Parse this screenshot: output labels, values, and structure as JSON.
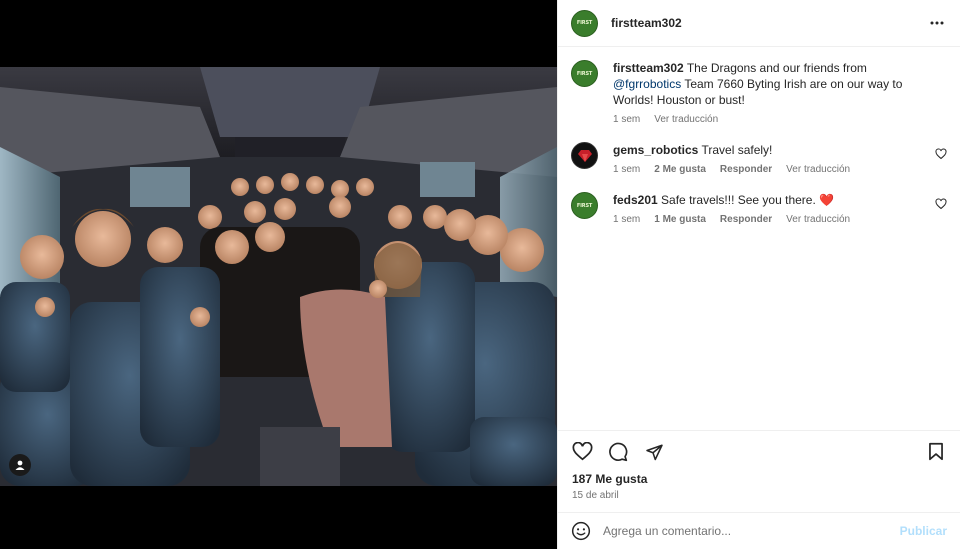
{
  "header": {
    "username": "firstteam302",
    "avatar_icon": "team-logo-icon",
    "more_icon": "more-options-icon"
  },
  "caption": {
    "username": "firstteam302",
    "text_before": "The Dragons and our friends from ",
    "mention": "@fgrrobotics",
    "text_after": " Team 7660 Byting Irish are on our way to Worlds! Houston or bust!",
    "time": "1 sem",
    "translate": "Ver traducción"
  },
  "comments": [
    {
      "username": "gems_robotics",
      "text": "Travel safely!",
      "time": "1 sem",
      "likes": "2 Me gusta",
      "reply": "Responder",
      "translate": "Ver traducción"
    },
    {
      "username": "feds201",
      "text": "Safe travels!!! See you there. ",
      "emoji": "❤️",
      "time": "1 sem",
      "likes": "1 Me gusta",
      "reply": "Responder",
      "translate": "Ver traducción"
    }
  ],
  "actions": {
    "like_icon": "heart-icon",
    "comment_icon": "comment-icon",
    "share_icon": "share-icon",
    "save_icon": "bookmark-icon"
  },
  "likes_count": "187 Me gusta",
  "date": "15 de abril",
  "add_comment": {
    "placeholder": "Agrega un comentario...",
    "publish": "Publicar",
    "emoji_icon": "smiley-icon"
  },
  "colors": {
    "avatar_green": "#3a7d2c",
    "mention": "#00376b",
    "publish_disabled": "#b2dffc",
    "heart_red": "#ed4956"
  }
}
